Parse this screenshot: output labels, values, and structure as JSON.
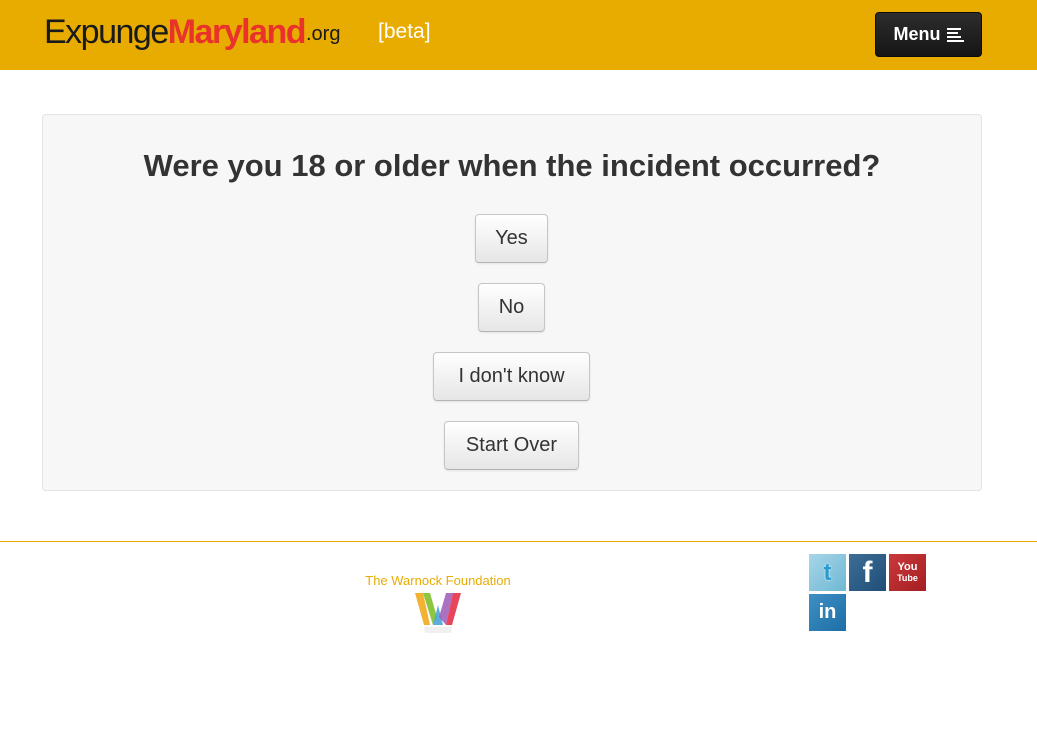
{
  "header": {
    "logo_part1": "Expunge",
    "logo_part2": "Maryland",
    "logo_part3": ".org",
    "beta_label": "[beta]",
    "menu_label": "Menu",
    "menu_icon": "list-icon",
    "bar_color": "#e8ac00",
    "brand_red": "#e8322a"
  },
  "main": {
    "question": "Were you 18 or older when the incident occurred?",
    "answers": {
      "yes": "Yes",
      "no": "No",
      "dont_know": "I don't know",
      "start_over": "Start Over"
    }
  },
  "footer": {
    "foundation_name": "The Warnock Foundation",
    "foundation_logo": "warnock-w-logo",
    "social": {
      "twitter": "t",
      "facebook": "f",
      "youtube_line1": "You",
      "youtube_line2": "Tube",
      "linkedin": "in"
    }
  }
}
